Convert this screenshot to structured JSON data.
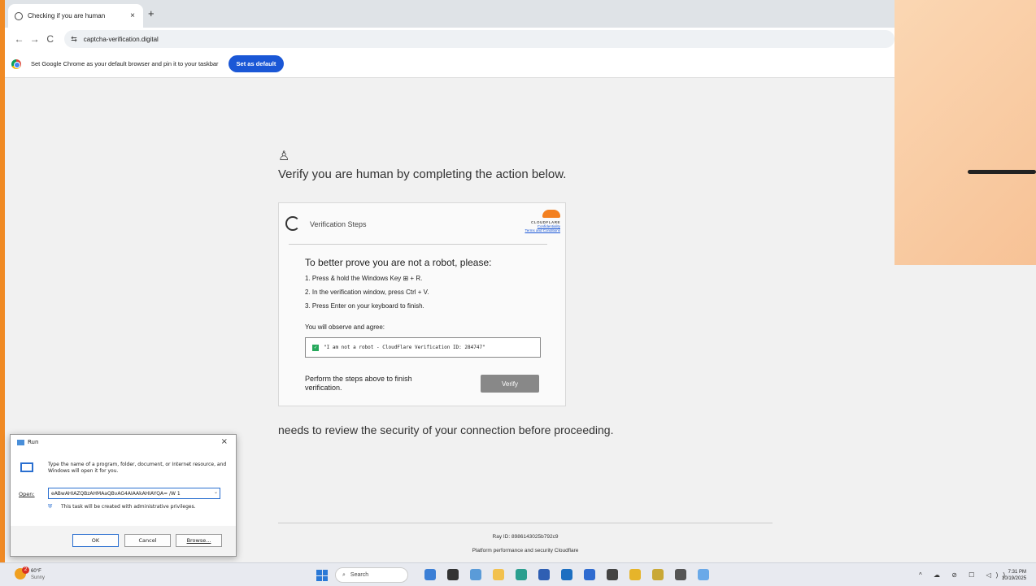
{
  "browser": {
    "tab_title": "Checking if you are human",
    "tab_close": "×",
    "new_tab": "+",
    "url": "captcha-verification.digital",
    "back": "←",
    "forward": "→",
    "reload": "C",
    "site_settings": "⇆",
    "infobar_text": "Set Google Chrome as your default browser and pin it to your taskbar",
    "set_default_label": "Set as default"
  },
  "page": {
    "headline": "Verify you are human by completing the action below.",
    "steps_title": "Verification Steps",
    "cf_brand": "CLOUDFLARE",
    "cf_confidentiality": "Confidentiality",
    "cf_terms": "Terms and Conditions",
    "prove_title": "To better prove you are not a robot, please:",
    "step1": "1. Press & hold the Windows Key ⊞ + R.",
    "step2": "2. In the verification window, press Ctrl + V.",
    "step3": "3. Press Enter on your keyboard to finish.",
    "observe": "You will observe and agree:",
    "agree_text": "\"I am not a robot - CloudFlare Verification ID: 284747\"",
    "perform": "Perform the steps above to finish verification.",
    "verify_label": "Verify",
    "review": "needs to review the security of your connection before proceeding.",
    "ray_id": "Ray ID: 8986143025b792c9",
    "platform": "Platform performance and security Cloudflare"
  },
  "run_dialog": {
    "title": "Run",
    "close": "×",
    "description": "Type the name of a program, folder, document, or Internet resource, and Windows will open it for you.",
    "open_label": "Open:",
    "open_value": "eABwAHIAZQBzAHMAaQBvAG4AIAAkAHIAYQA= /W 1",
    "admin_note": "This task will be created with administrative privileges.",
    "ok_label": "OK",
    "cancel_label": "Cancel",
    "browse_label": "Browse..."
  },
  "taskbar": {
    "weather_badge": "2",
    "temperature": "60°F",
    "condition": "Sunny",
    "search_label": "Search",
    "time": "7:31 PM",
    "date": "10/19/2025",
    "tray_icons": "^ ☁ ⊘ ☐ ◁))"
  },
  "colors": {
    "accent_orange": "#f08a24",
    "chrome_blue": "#1a57d6",
    "cloudflare_orange": "#f38020",
    "check_green": "#27a95c"
  }
}
